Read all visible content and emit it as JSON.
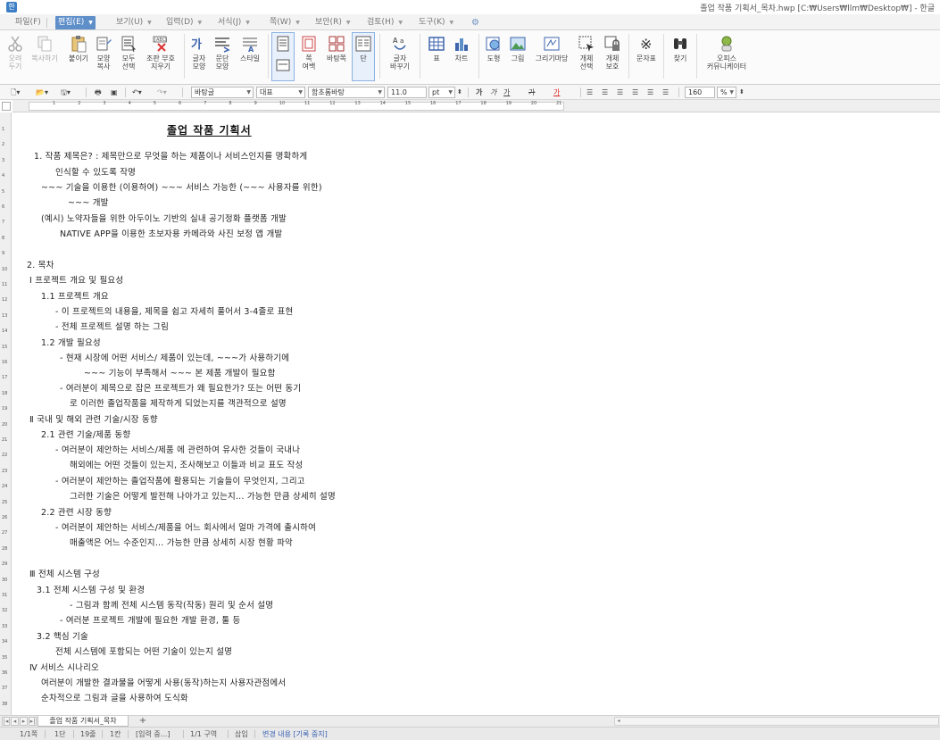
{
  "window": {
    "icon_glyph": "한",
    "title": "졸업 작품 기획서_목차.hwp [C:₩Users₩llm₩Desktop₩] - 한글"
  },
  "menu": [
    {
      "label": "파일(F)",
      "active": false
    },
    {
      "label": "편집(E)",
      "active": true
    },
    {
      "label": "보기(U)",
      "active": false
    },
    {
      "label": "입력(D)",
      "active": false
    },
    {
      "label": "서식(J)",
      "active": false
    },
    {
      "label": "쪽(W)",
      "active": false
    },
    {
      "label": "보안(R)",
      "active": false
    },
    {
      "label": "검토(H)",
      "active": false
    },
    {
      "label": "도구(K)",
      "active": false
    }
  ],
  "ribbon": {
    "cut": "오려\n두기",
    "copy": "복사하기",
    "paste": "붙이기",
    "format_copy": "모양\n복사",
    "select_all": "모두\n선택",
    "clear_marks": "조판 부호\n지우기",
    "char_shape": "글자\n모양",
    "para_shape": "문단\n모양",
    "style": "스타일",
    "page_layout": "",
    "col": "쪽\n여백",
    "background": "바탕쪽",
    "columns": "단",
    "change_case": "글자\n바꾸기",
    "table": "표",
    "chart": "차트",
    "shape": "도형",
    "picture": "그림",
    "draw": "그리기마당",
    "obj_select": "개체\n선택",
    "obj_protect": "개체\n보호",
    "symbol": "문자표",
    "find": "찾기",
    "office": "오피스\n커뮤니케이터"
  },
  "format": {
    "style": "바탕글",
    "lang": "대표",
    "font": "함초롬바탕",
    "size": "11.0",
    "size_unit": "pt",
    "bold": "가",
    "italic": "가",
    "underline": "가",
    "strike": "가",
    "color": "가",
    "zoom": "160",
    "zoom_unit": "%"
  },
  "ruler_numbers": [
    "1",
    "2",
    "3",
    "4",
    "5",
    "6",
    "7",
    "8",
    "9",
    "10",
    "11",
    "12",
    "13",
    "14",
    "15",
    "16",
    "17",
    "18",
    "19",
    "20",
    "21"
  ],
  "vruler_numbers": [
    "1",
    "2",
    "3",
    "4",
    "5",
    "6",
    "7",
    "8",
    "9",
    "10",
    "11",
    "12",
    "13",
    "14",
    "15",
    "16",
    "17",
    "18",
    "19",
    "20",
    "21",
    "22",
    "23",
    "24",
    "25",
    "26",
    "27",
    "28",
    "29",
    "30",
    "31",
    "32",
    "33",
    "34",
    "35",
    "36",
    "37",
    "38"
  ],
  "doc": {
    "title": "졸업 작품 기획서",
    "lines": [
      "1. 작품 제목은? : 제목만으로 무엇을 하는 제품이나 서비스인지를 명확하게",
      "인식할 수 있도록 작명",
      "~~~ 기술을 이용한 (이용하여)  ~~~ 서비스 가능한 (~~~ 사용자를 위한)",
      "~~~ 개발",
      "(예시) 노약자들을 위한 아두이노 기반의 실내 공기정화 플랫폼 개발",
      "NATIVE APP을 이용한 초보자용 카메라와 사진 보정 앱 개발",
      "2. 목차",
      "Ⅰ  프로젝트 개요 및 필요성",
      "1.1 프로젝트 개요",
      "- 이 프로젝트의 내용을, 제목을 쉽고 자세히 풀어서 3-4줄로 표현",
      "- 전체 프로젝트 설명 하는 그림",
      "1.2 개발 필요성",
      "- 현재 시장에 어떤 서비스/ 제품이 있는데, ~~~가 사용하기에",
      "~~~ 기능이 부족해서 ~~~ 본 제품 개발이 필요함",
      "- 여러분이 제목으로 잡은 프로젝트가 왜 필요한가?  또는 어떤 동기",
      "로 이러한 졸업작품을 제작하게 되었는지를 객관적으로  설명",
      "Ⅱ  국내 및 해외 관련 기술/시장 동향",
      "2.1 관련 기술/제품 동향",
      "-  여러분이  제안하는  서비스/제품  에  관련하여  유사한  것들이  국내나",
      "해외에는 어떤 것들이 있는지, 조사해보고 이들과 비교 표도 작성",
      "-  여러분이  제안하는  졸업작품에  활용되는  기술들이  무엇인지,  그리고",
      "그러한 기술은 어떻게 발전해 나아가고 있는지... 가능한 만큼 상세히  설명",
      "2.2  관련 시장 동향",
      "-  여러분이  제안하는  서비스/제품을  어느  회사에서  얼마  가격에  출시하여",
      "매출액은 어느 수준인지... 가능한 만큼 상세히 시장 현황 파악",
      "Ⅲ  전체 시스템 구성",
      "3.1 전체 시스템 구성 및 환경",
      "- 그림과 함께 전체 시스템 동작(작동) 원리 및 순서 설명",
      "- 여러분 프로젝트 개발에 필요한 개발 환경, 툴 등",
      "3.2 핵심 기술",
      "전체 시스템에 포함되는 어떤 기술이 있는지 설명",
      "Ⅳ  서비스 시나리오",
      "여러분이 개발한 결과물을 어떻게 사용(동작)하는지 사용자관점에서",
      "순차적으로 그림과 글을 사용하여 도식화"
    ]
  },
  "tabs": {
    "doc_tab": "졸업 작품 기획서_목차",
    "add": "+"
  },
  "status": {
    "page": "1/1쪽",
    "column": "1단",
    "line": "19줄",
    "col": "1칸",
    "mode": "[입력 중...]",
    "section": "1/1 구역",
    "insert": "삽입",
    "track": "변경 내용 [기록 중지]"
  }
}
